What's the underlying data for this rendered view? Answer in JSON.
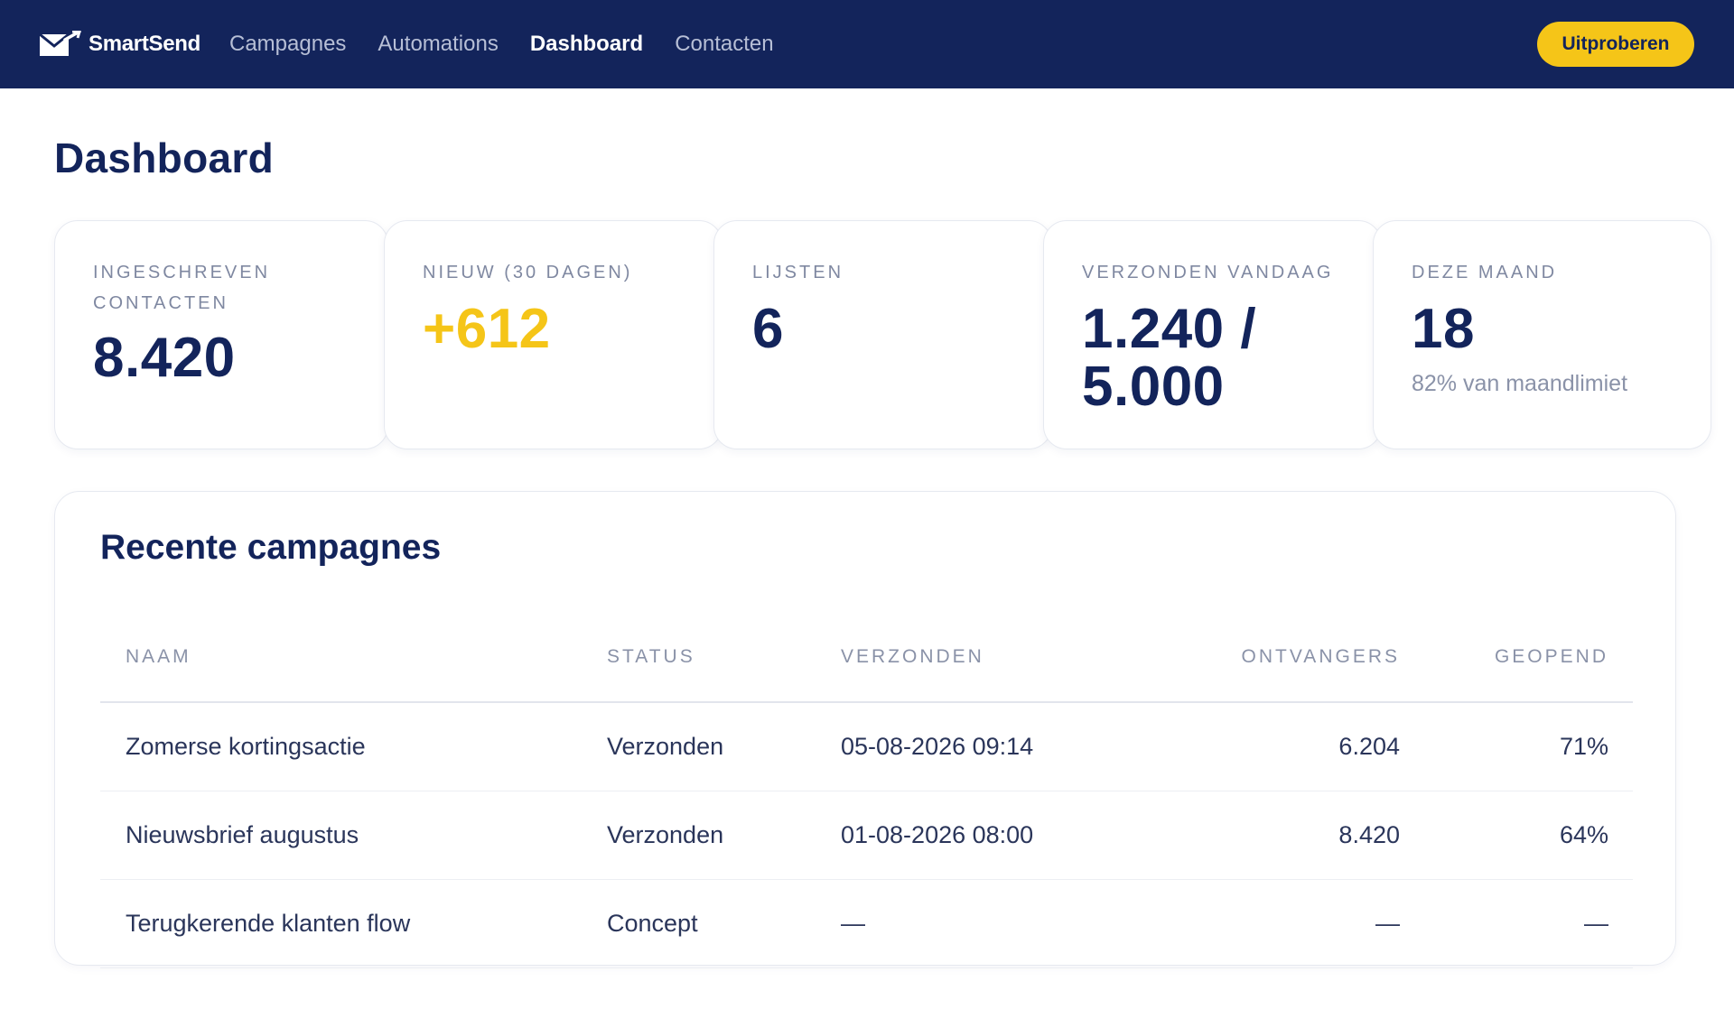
{
  "app": {
    "name": "SmartSend"
  },
  "nav": {
    "links": [
      {
        "label": "Campagnes",
        "active": false
      },
      {
        "label": "Automations",
        "active": false
      },
      {
        "label": "Dashboard",
        "active": true
      },
      {
        "label": "Contacten",
        "active": false
      }
    ],
    "cta_label": "Uitproberen"
  },
  "page": {
    "title": "Dashboard"
  },
  "stats": [
    {
      "label": "Ingeschreven contacten",
      "value": "8.420",
      "sub": ""
    },
    {
      "label": "Nieuw (30 dagen)",
      "value": "+612",
      "sub": ""
    },
    {
      "label": "Lijsten",
      "value": "6",
      "sub": ""
    },
    {
      "label": "Verzonden vandaag",
      "value": "1.240 / 5.000",
      "sub": ""
    },
    {
      "label": "Deze maand",
      "value": "18",
      "sub": "82% van maandlimiet"
    }
  ],
  "campaigns": {
    "title": "Recente campagnes",
    "columns": {
      "name": "NAAM",
      "status": "STATUS",
      "sent": "VERZONDEN",
      "recipients": "ONTVANGERS",
      "opened": "GEOPEND"
    },
    "rows": [
      {
        "name": "Zomerse kortingsactie",
        "status": "Verzonden",
        "sent": "05-08-2026 09:14",
        "recipients": "6.204",
        "opened": "71%"
      },
      {
        "name": "Nieuwsbrief augustus",
        "status": "Verzonden",
        "sent": "01-08-2026 08:00",
        "recipients": "8.420",
        "opened": "64%"
      },
      {
        "name": "Terugkerende klanten flow",
        "status": "Concept",
        "sent": "—",
        "recipients": "—",
        "opened": "—"
      }
    ]
  },
  "colors": {
    "nav_bg": "#13245b",
    "accent": "#f5c518",
    "text_primary": "#13245b",
    "text_muted": "#8a92a8"
  }
}
